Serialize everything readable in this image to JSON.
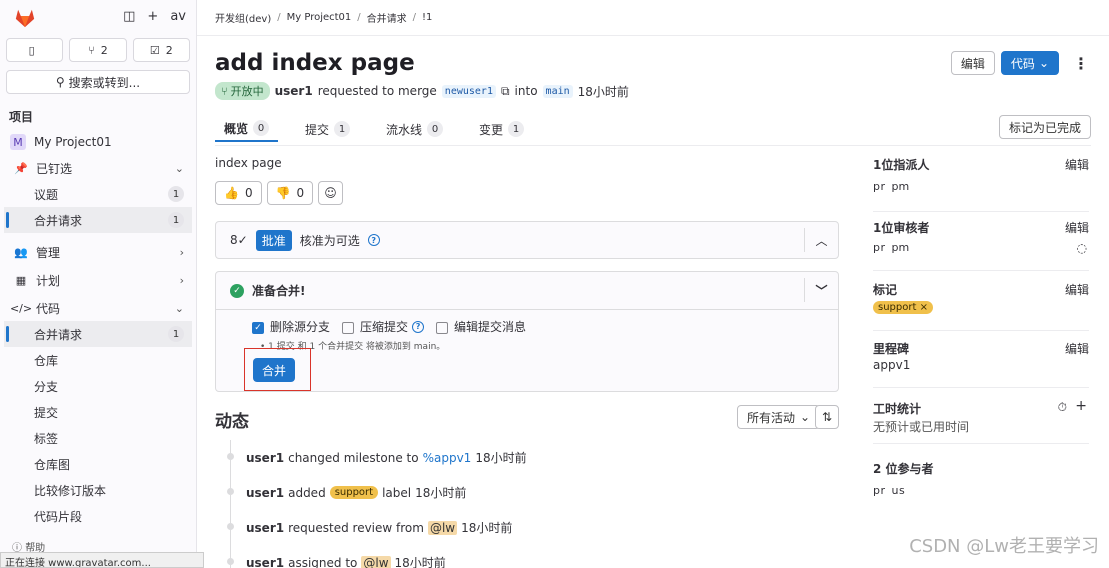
{
  "sidebar": {
    "avatar": "av",
    "counters": [
      {
        "icon": "issue-icon",
        "count": ""
      },
      {
        "icon": "merge-request-icon",
        "count": "2"
      },
      {
        "icon": "todo-icon",
        "count": "2"
      }
    ],
    "search_label": "搜索或转到...",
    "section_title": "项目",
    "project_initial": "M",
    "project_name": "My Project01",
    "pinned": "已钉选",
    "pinned_items": [
      {
        "label": "议题",
        "count": "1"
      },
      {
        "label": "合并请求",
        "count": "1"
      }
    ],
    "manage": "管理",
    "plan": "计划",
    "code": "代码",
    "code_items": [
      {
        "label": "合并请求",
        "count": "1"
      },
      {
        "label": "仓库"
      },
      {
        "label": "分支"
      },
      {
        "label": "提交"
      },
      {
        "label": "标签"
      },
      {
        "label": "仓库图"
      },
      {
        "label": "比较修订版本"
      },
      {
        "label": "代码片段"
      }
    ],
    "help": "帮助",
    "status_bar": "正在连接 www.gravatar.com..."
  },
  "breadcrumb": [
    "开发组(dev)",
    "My Project01",
    "合并请求",
    "!1"
  ],
  "header": {
    "title": "add index page",
    "edit_label": "编辑",
    "code_label": "代码",
    "status": "开放中",
    "author": "user1",
    "requested_text": "requested to merge",
    "source_branch": "newuser1",
    "into_text": "into",
    "target_branch": "main",
    "time": "18小时前"
  },
  "tabs": [
    {
      "label": "概览",
      "count": "0"
    },
    {
      "label": "提交",
      "count": "1"
    },
    {
      "label": "流水线",
      "count": "0"
    },
    {
      "label": "变更",
      "count": "1"
    }
  ],
  "mark_done_label": "标记为已完成",
  "description": "index page",
  "reactions": {
    "thumbs_up": "0",
    "thumbs_down": "0"
  },
  "approval": {
    "button": "批准",
    "text": "核准为可选"
  },
  "merge": {
    "title": "准备合并!",
    "opt_delete": "删除源分支",
    "opt_squash": "压缩提交",
    "opt_edit_msg": "编辑提交消息",
    "note": "• 1 提交 和 1 个合并提交 将被添加到 main。",
    "button": "合并"
  },
  "activity": {
    "title": "动态",
    "filter": "所有活动",
    "items": [
      {
        "user": "user1",
        "text": "changed milestone to",
        "link": "%appv1",
        "time": "18小时前"
      },
      {
        "user": "user1",
        "text": "added",
        "label": "support",
        "text2": "label",
        "time": "18小时前"
      },
      {
        "user": "user1",
        "text": "requested review from",
        "mention": "@lw",
        "time": "18小时前"
      },
      {
        "user": "user1",
        "text": "assigned to",
        "mention": "@lw",
        "time": "18小时前"
      }
    ]
  },
  "right": {
    "assignee_title": "1位指派人",
    "assignee_avatar": "pr",
    "assignee_name": "pm",
    "reviewer_title": "1位审核者",
    "reviewer_avatar": "pr",
    "reviewer_name": "pm",
    "labels_title": "标记",
    "label_value": "support ×",
    "milestone_title": "里程碑",
    "milestone_value": "appv1",
    "time_title": "工时统计",
    "time_value": "无预计或已用时间",
    "participants_title": "2 位参与者",
    "participants": [
      "pr",
      "us"
    ],
    "edit": "编辑"
  },
  "watermark": "CSDN @Lw老王要学习"
}
